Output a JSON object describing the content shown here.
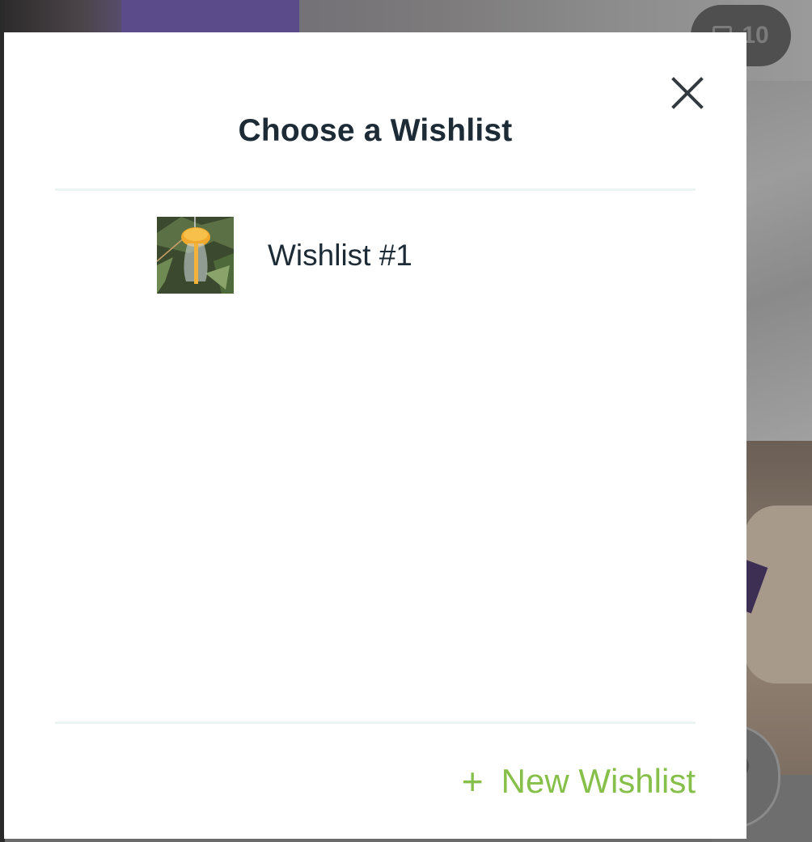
{
  "background": {
    "photo_count": "10"
  },
  "modal": {
    "title": "Choose a Wishlist",
    "close_icon": "close-icon",
    "wishlists": [
      {
        "name": "Wishlist #1",
        "thumbnail_icon": "product-thumbnail"
      }
    ],
    "new_wishlist": {
      "icon": "plus-icon",
      "label": "New Wishlist"
    }
  },
  "colors": {
    "accent": "#86c04a",
    "text": "#1c2b36",
    "divider": "#eef3f3",
    "overlay": "#6a6a6a"
  }
}
